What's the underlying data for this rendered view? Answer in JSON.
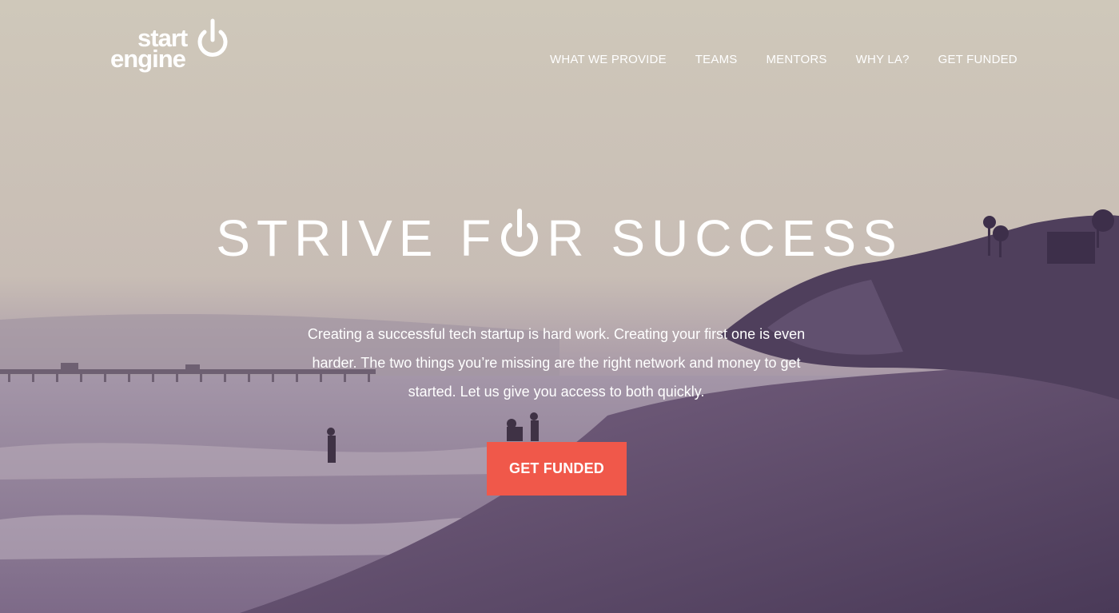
{
  "logo": {
    "line1": "start",
    "line2": "engine"
  },
  "nav": {
    "items": [
      {
        "label": "WHAT WE PROVIDE"
      },
      {
        "label": "TEAMS"
      },
      {
        "label": "MENTORS"
      },
      {
        "label": "WHY LA?"
      },
      {
        "label": "GET FUNDED"
      }
    ]
  },
  "hero": {
    "headline_part1": "STRIVE F",
    "headline_part2": "R SUCCESS",
    "subtext": "Creating a successful tech startup is hard work. Creating your first one is even harder. The two things you’re missing are the right network and money to get started. Let us give you access to both quickly.",
    "cta_label": "GET FUNDED"
  },
  "colors": {
    "cta_background": "#f0584a",
    "text": "#ffffff"
  }
}
